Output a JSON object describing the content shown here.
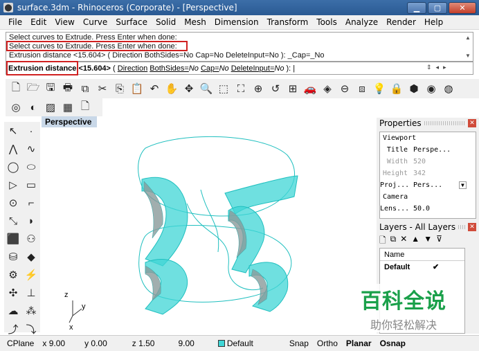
{
  "window": {
    "title": "surface.3dm - Rhinoceros (Corporate) - [Perspective]"
  },
  "menu": [
    "File",
    "Edit",
    "View",
    "Curve",
    "Surface",
    "Solid",
    "Mesh",
    "Dimension",
    "Transform",
    "Tools",
    "Analyze",
    "Render",
    "Help"
  ],
  "history": [
    "Select curves to Extrude. Press Enter when done:",
    "Select curves to Extrude. Press Enter when done:",
    "Extrusion distance <15.604> ( Direction  BothSides=No  Cap=No  DeleteInput=No ): _Cap=_No"
  ],
  "command": {
    "prompt": "Extrusion distance",
    "default": "<15.604>",
    "open": "(",
    "opt1": "Direction",
    "opt2k": "BothSides=",
    "opt2v": "No",
    "opt3k": "Cap=",
    "opt3v": "No",
    "opt4k": "DeleteInput=",
    "opt4v": "No",
    "close": "):"
  },
  "viewport": {
    "name": "Perspective",
    "axis_z": "z",
    "axis_y": "y",
    "axis_x": "x"
  },
  "properties": {
    "title": "Properties",
    "section": "Viewport",
    "rows": [
      {
        "k": "Title",
        "v": "Perspe..."
      },
      {
        "k": "Width",
        "v": "520"
      },
      {
        "k": "Height",
        "v": "342"
      },
      {
        "k": "Proj...",
        "v": "Pers..."
      }
    ],
    "camera": "Camera",
    "lens_k": "Lens...",
    "lens_v": "50.0"
  },
  "layers": {
    "title": "Layers - All Layers",
    "header": "Name",
    "rows": [
      {
        "name": "Default",
        "check": "✔"
      }
    ]
  },
  "status": {
    "cplane": "CPlane",
    "x": "x 9.00",
    "y": "y 0.00",
    "z": "z 1.50",
    "dist": "9.00",
    "layer": "Default",
    "snap": "Snap",
    "ortho": "Ortho",
    "planar": "Planar",
    "osnap": "Osnap"
  },
  "watermark": {
    "big": "百科全说",
    "small": "助你轻松解决"
  },
  "colors": {
    "accent": "#1fbfbf",
    "surface": "#3fd6d6",
    "highlight": "#d02020"
  }
}
